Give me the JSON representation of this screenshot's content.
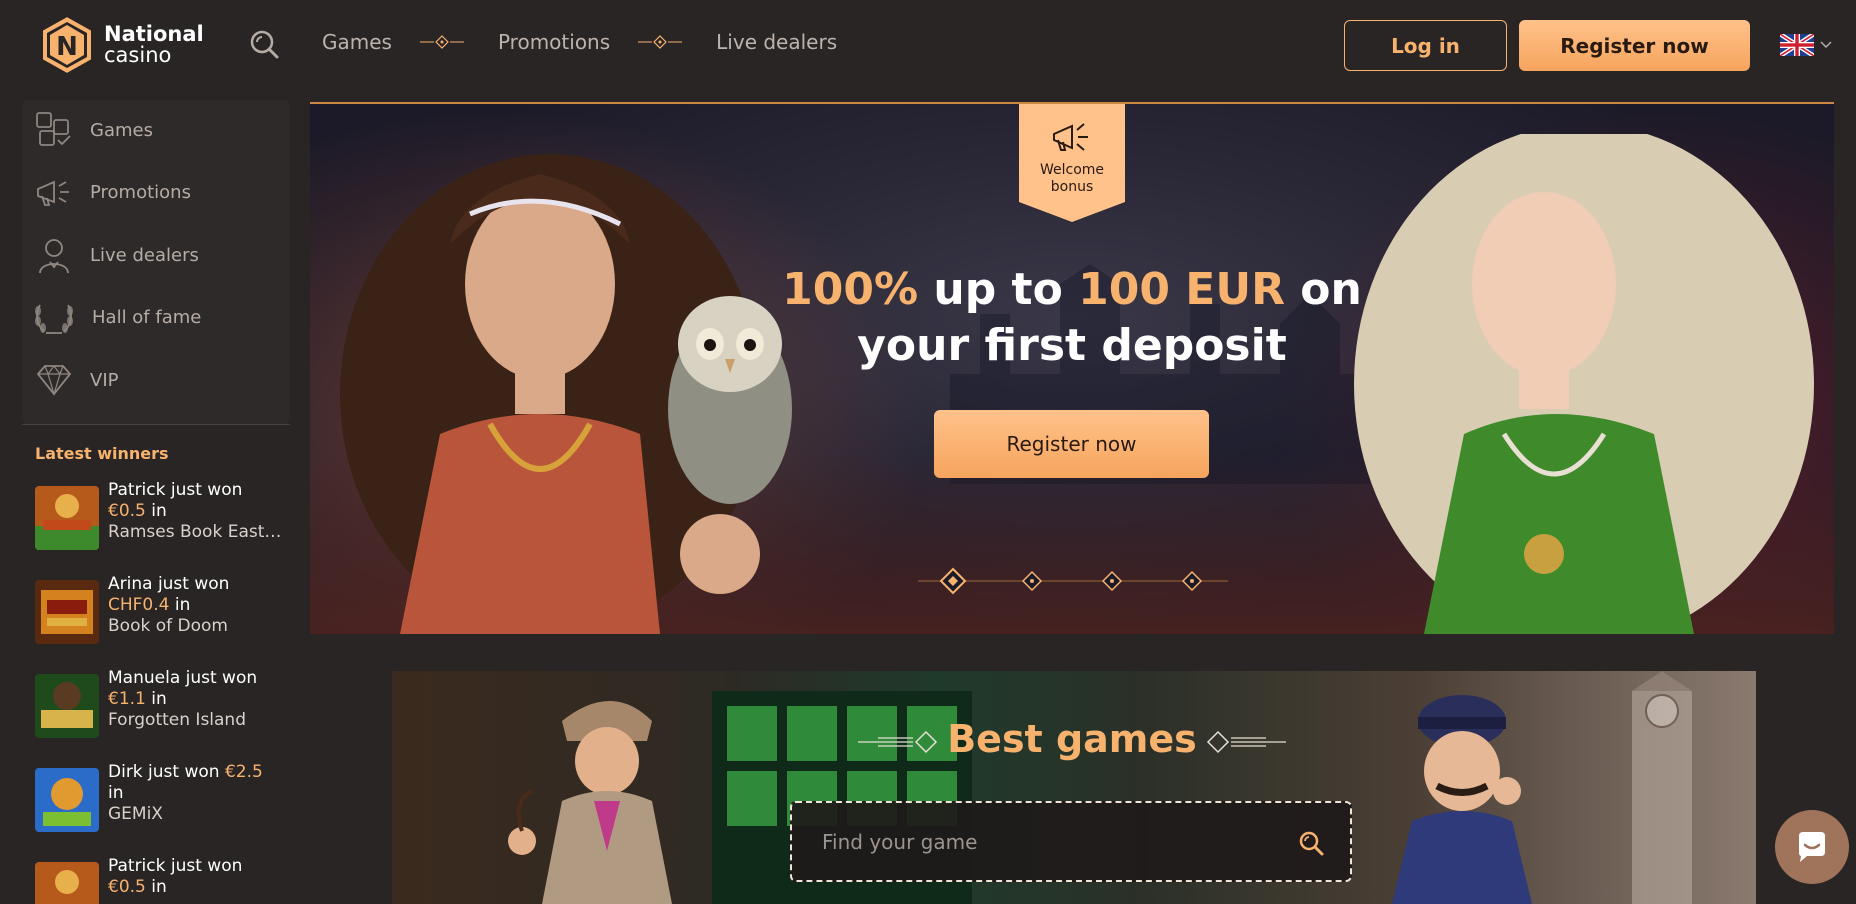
{
  "header": {
    "logo": {
      "line1": "National",
      "line2": "casino",
      "badge_letter": "N"
    },
    "nav": [
      {
        "label": "Games"
      },
      {
        "label": "Promotions"
      },
      {
        "label": "Live dealers"
      }
    ],
    "login_label": "Log in",
    "register_label": "Register now",
    "language_icon": "uk-flag-icon"
  },
  "sidebar": {
    "items": [
      {
        "label": "Games",
        "icon": "puzzle-icon"
      },
      {
        "label": "Promotions",
        "icon": "megaphone-icon"
      },
      {
        "label": "Live dealers",
        "icon": "dealer-icon"
      },
      {
        "label": "Hall of fame",
        "icon": "laurel-icon"
      },
      {
        "label": "VIP",
        "icon": "diamond-icon"
      }
    ],
    "winners_title": "Latest winners",
    "winners": [
      {
        "name": "Patrick just won",
        "amount": "€0.5",
        "in": "in",
        "game": "Ramses Book Easter Egg"
      },
      {
        "name": "Arina just won",
        "amount": "CHF0.4",
        "in": "in",
        "game": "Book of Doom"
      },
      {
        "name": "Manuela just won",
        "amount": "€1.1",
        "in": "in",
        "game": "Forgotten Island"
      },
      {
        "name": "Dirk just won",
        "amount": "€2.5",
        "in": "in",
        "game": "GEMiX"
      },
      {
        "name": "Patrick just won",
        "amount": "€0.5",
        "in": "in",
        "game": ""
      }
    ]
  },
  "hero": {
    "badge_line1": "Welcome",
    "badge_line2": "bonus",
    "title_hl1": "100%",
    "title_mid": " up to ",
    "title_hl2": "100 EUR",
    "title_end": " on your first deposit",
    "cta_label": "Register now",
    "slide_count": 4,
    "active_slide": 1
  },
  "best_games": {
    "title": "Best games",
    "search_placeholder": "Find your game"
  },
  "colors": {
    "accent": "#f7b26e",
    "background": "#2a2525",
    "sidebar": "#2f2a2a",
    "muted_text": "#b5aca6"
  }
}
